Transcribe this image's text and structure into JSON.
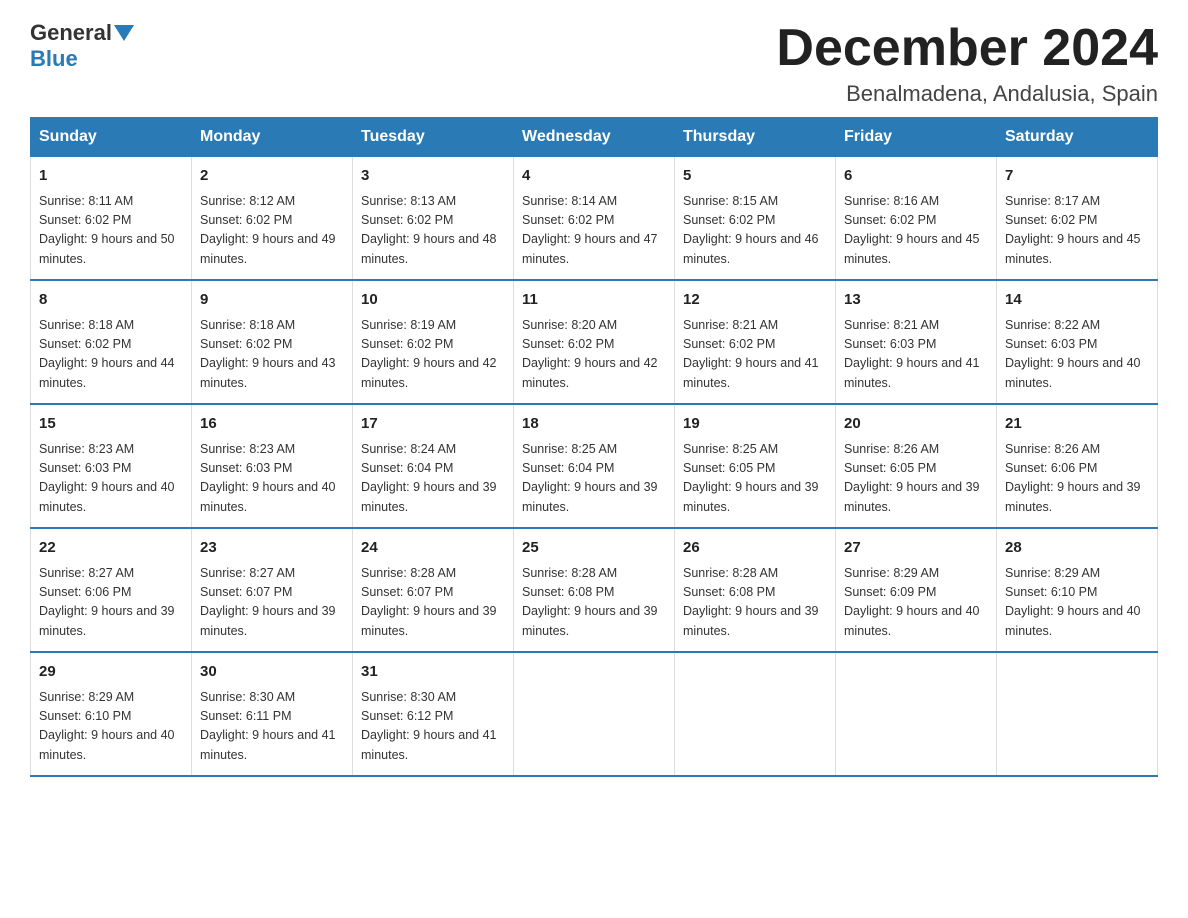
{
  "header": {
    "logo_general": "General",
    "logo_blue": "Blue",
    "month_title": "December 2024",
    "location": "Benalmadena, Andalusia, Spain"
  },
  "days_of_week": [
    "Sunday",
    "Monday",
    "Tuesday",
    "Wednesday",
    "Thursday",
    "Friday",
    "Saturday"
  ],
  "weeks": [
    [
      {
        "day": "1",
        "sunrise": "8:11 AM",
        "sunset": "6:02 PM",
        "daylight": "9 hours and 50 minutes."
      },
      {
        "day": "2",
        "sunrise": "8:12 AM",
        "sunset": "6:02 PM",
        "daylight": "9 hours and 49 minutes."
      },
      {
        "day": "3",
        "sunrise": "8:13 AM",
        "sunset": "6:02 PM",
        "daylight": "9 hours and 48 minutes."
      },
      {
        "day": "4",
        "sunrise": "8:14 AM",
        "sunset": "6:02 PM",
        "daylight": "9 hours and 47 minutes."
      },
      {
        "day": "5",
        "sunrise": "8:15 AM",
        "sunset": "6:02 PM",
        "daylight": "9 hours and 46 minutes."
      },
      {
        "day": "6",
        "sunrise": "8:16 AM",
        "sunset": "6:02 PM",
        "daylight": "9 hours and 45 minutes."
      },
      {
        "day": "7",
        "sunrise": "8:17 AM",
        "sunset": "6:02 PM",
        "daylight": "9 hours and 45 minutes."
      }
    ],
    [
      {
        "day": "8",
        "sunrise": "8:18 AM",
        "sunset": "6:02 PM",
        "daylight": "9 hours and 44 minutes."
      },
      {
        "day": "9",
        "sunrise": "8:18 AM",
        "sunset": "6:02 PM",
        "daylight": "9 hours and 43 minutes."
      },
      {
        "day": "10",
        "sunrise": "8:19 AM",
        "sunset": "6:02 PM",
        "daylight": "9 hours and 42 minutes."
      },
      {
        "day": "11",
        "sunrise": "8:20 AM",
        "sunset": "6:02 PM",
        "daylight": "9 hours and 42 minutes."
      },
      {
        "day": "12",
        "sunrise": "8:21 AM",
        "sunset": "6:02 PM",
        "daylight": "9 hours and 41 minutes."
      },
      {
        "day": "13",
        "sunrise": "8:21 AM",
        "sunset": "6:03 PM",
        "daylight": "9 hours and 41 minutes."
      },
      {
        "day": "14",
        "sunrise": "8:22 AM",
        "sunset": "6:03 PM",
        "daylight": "9 hours and 40 minutes."
      }
    ],
    [
      {
        "day": "15",
        "sunrise": "8:23 AM",
        "sunset": "6:03 PM",
        "daylight": "9 hours and 40 minutes."
      },
      {
        "day": "16",
        "sunrise": "8:23 AM",
        "sunset": "6:03 PM",
        "daylight": "9 hours and 40 minutes."
      },
      {
        "day": "17",
        "sunrise": "8:24 AM",
        "sunset": "6:04 PM",
        "daylight": "9 hours and 39 minutes."
      },
      {
        "day": "18",
        "sunrise": "8:25 AM",
        "sunset": "6:04 PM",
        "daylight": "9 hours and 39 minutes."
      },
      {
        "day": "19",
        "sunrise": "8:25 AM",
        "sunset": "6:05 PM",
        "daylight": "9 hours and 39 minutes."
      },
      {
        "day": "20",
        "sunrise": "8:26 AM",
        "sunset": "6:05 PM",
        "daylight": "9 hours and 39 minutes."
      },
      {
        "day": "21",
        "sunrise": "8:26 AM",
        "sunset": "6:06 PM",
        "daylight": "9 hours and 39 minutes."
      }
    ],
    [
      {
        "day": "22",
        "sunrise": "8:27 AM",
        "sunset": "6:06 PM",
        "daylight": "9 hours and 39 minutes."
      },
      {
        "day": "23",
        "sunrise": "8:27 AM",
        "sunset": "6:07 PM",
        "daylight": "9 hours and 39 minutes."
      },
      {
        "day": "24",
        "sunrise": "8:28 AM",
        "sunset": "6:07 PM",
        "daylight": "9 hours and 39 minutes."
      },
      {
        "day": "25",
        "sunrise": "8:28 AM",
        "sunset": "6:08 PM",
        "daylight": "9 hours and 39 minutes."
      },
      {
        "day": "26",
        "sunrise": "8:28 AM",
        "sunset": "6:08 PM",
        "daylight": "9 hours and 39 minutes."
      },
      {
        "day": "27",
        "sunrise": "8:29 AM",
        "sunset": "6:09 PM",
        "daylight": "9 hours and 40 minutes."
      },
      {
        "day": "28",
        "sunrise": "8:29 AM",
        "sunset": "6:10 PM",
        "daylight": "9 hours and 40 minutes."
      }
    ],
    [
      {
        "day": "29",
        "sunrise": "8:29 AM",
        "sunset": "6:10 PM",
        "daylight": "9 hours and 40 minutes."
      },
      {
        "day": "30",
        "sunrise": "8:30 AM",
        "sunset": "6:11 PM",
        "daylight": "9 hours and 41 minutes."
      },
      {
        "day": "31",
        "sunrise": "8:30 AM",
        "sunset": "6:12 PM",
        "daylight": "9 hours and 41 minutes."
      },
      {
        "day": "",
        "sunrise": "",
        "sunset": "",
        "daylight": ""
      },
      {
        "day": "",
        "sunrise": "",
        "sunset": "",
        "daylight": ""
      },
      {
        "day": "",
        "sunrise": "",
        "sunset": "",
        "daylight": ""
      },
      {
        "day": "",
        "sunrise": "",
        "sunset": "",
        "daylight": ""
      }
    ]
  ]
}
